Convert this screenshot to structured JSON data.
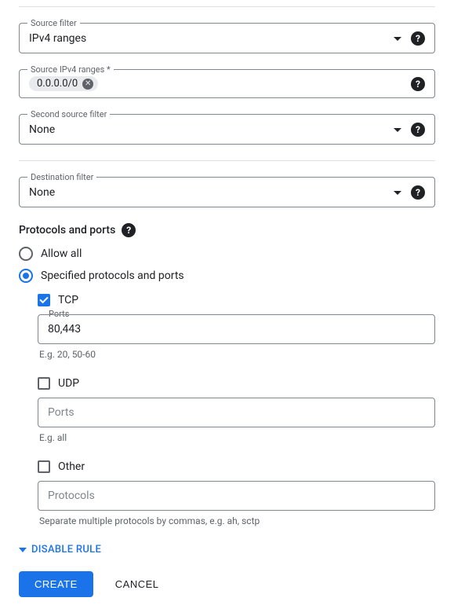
{
  "source_filter": {
    "label": "Source filter",
    "value": "IPv4 ranges"
  },
  "source_ipv4": {
    "label": "Source IPv4 ranges *",
    "chip": "0.0.0.0/0"
  },
  "second_source_filter": {
    "label": "Second source filter",
    "value": "None"
  },
  "destination_filter": {
    "label": "Destination filter",
    "value": "None"
  },
  "protocols_header": "Protocols and ports",
  "radio_allow_all": "Allow all",
  "radio_specified": "Specified protocols and ports",
  "tcp": {
    "label": "TCP",
    "ports_label": "Ports",
    "ports_value": "80,443",
    "hint": "E.g. 20, 50-60"
  },
  "udp": {
    "label": "UDP",
    "ports_placeholder": "Ports",
    "hint": "E.g. all"
  },
  "other": {
    "label": "Other",
    "protocols_placeholder": "Protocols",
    "hint": "Separate multiple protocols by commas, e.g. ah, sctp"
  },
  "disable_rule": "DISABLE RULE",
  "create": "CREATE",
  "cancel": "CANCEL"
}
